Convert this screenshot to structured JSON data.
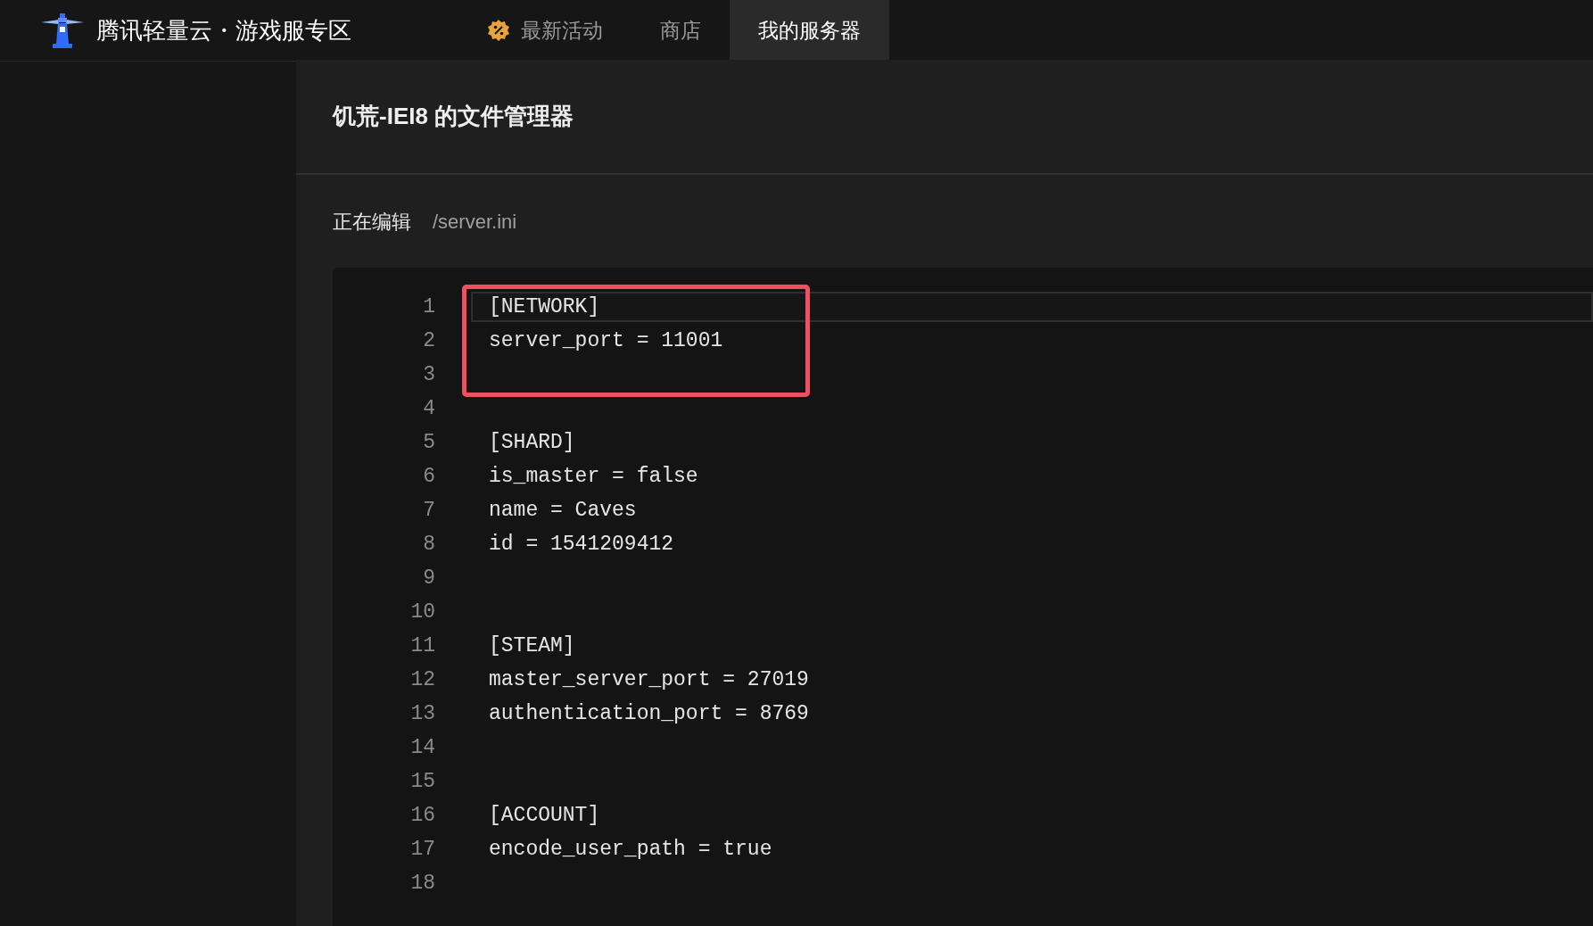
{
  "header": {
    "brand": "腾讯轻量云・游戏服专区",
    "nav": [
      {
        "label": "最新活动",
        "selected": false
      },
      {
        "label": "商店",
        "selected": false
      },
      {
        "label": "我的服务器",
        "selected": true
      }
    ]
  },
  "panel": {
    "title": "饥荒-IEI8 的文件管理器",
    "editing_label": "正在编辑",
    "file_path": "/server.ini"
  },
  "editor": {
    "lines": [
      {
        "number": "1",
        "text": "[NETWORK]",
        "active": true,
        "annotated": true
      },
      {
        "number": "2",
        "text": "server_port = 11001",
        "active": false,
        "annotated": true
      },
      {
        "number": "3",
        "active": false,
        "annotated": true
      },
      {
        "number": "4",
        "active": false,
        "annotated": false
      },
      {
        "number": "5",
        "text": "[SHARD]",
        "active": false,
        "annotated": false
      },
      {
        "number": "6",
        "text": "is_master = false",
        "active": false,
        "annotated": false
      },
      {
        "number": "7",
        "text": "name = Caves",
        "active": false,
        "annotated": false
      },
      {
        "number": "8",
        "text": "id = 1541209412",
        "active": false,
        "annotated": false
      },
      {
        "number": "9",
        "active": false,
        "annotated": false
      },
      {
        "number": "10",
        "active": false,
        "annotated": false
      },
      {
        "number": "11",
        "text": "[STEAM]",
        "active": false,
        "annotated": false
      },
      {
        "number": "12",
        "text": "master_server_port = 27019",
        "active": false,
        "annotated": false
      },
      {
        "number": "13",
        "text": "authentication_port = 8769",
        "active": false,
        "annotated": false
      },
      {
        "number": "14",
        "active": false,
        "annotated": false
      },
      {
        "number": "15",
        "active": false,
        "annotated": false
      },
      {
        "number": "16",
        "text": "[ACCOUNT]",
        "active": false,
        "annotated": false
      },
      {
        "number": "17",
        "text": "encode_user_path = true",
        "active": false,
        "annotated": false
      },
      {
        "number": "18",
        "active": false,
        "annotated": false
      }
    ]
  }
}
